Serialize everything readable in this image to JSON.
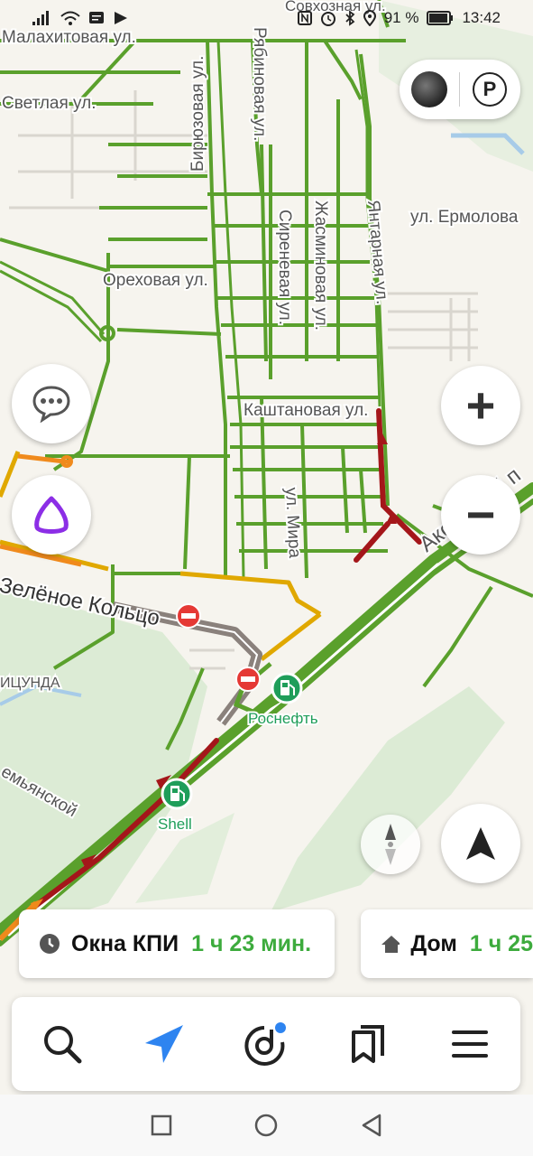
{
  "status_bar": {
    "battery_percent": "91 %",
    "time": "13:42"
  },
  "map": {
    "street_labels": {
      "malakhitovaya": "Малахитовая ул.",
      "sovkhoznaya": "Совхозная ул.",
      "svetlaya": "Светлая ул.",
      "biryuzovaya": "Бирюзовая ул.",
      "ryabinovaya": "Рябиновая ул.",
      "zhasminovaya": "Жасминовая ул.",
      "sirenevaya": "Сиреневая ул.",
      "yantarnaya": "Янтарная ул.",
      "ermolova": "ул. Ермолова",
      "orekhovaya": "Ореховая ул.",
      "kashtanovaya": "Каштановая ул.",
      "mira": "ул. Мира",
      "aksayskiy": "Аксайский п",
      "zelenoe_koltso": "Зелёное Кольцо",
      "pitsunda": "ИЦУНДА",
      "demyanskoy": "емьянской"
    },
    "pois": [
      {
        "name": "Роснефть",
        "icon": "fuel-station-icon"
      },
      {
        "name": "Shell",
        "icon": "fuel-station-icon"
      }
    ],
    "colors": {
      "traffic_free": "#5aa02c",
      "traffic_slow": "#e0a800",
      "traffic_jam": "#a4161a",
      "road_closed": "#8a817c",
      "closure_marker": "#e53935",
      "poi_green": "#1f9e5a"
    }
  },
  "map_controls": {
    "layers_icon": "layers-circle-icon",
    "parking_label": "P",
    "zoom_in_label": "+",
    "zoom_out_label": "−"
  },
  "route_cards": [
    {
      "name": "Окна КПИ",
      "time": "1 ч 23 мин.",
      "icon": "clock-icon"
    },
    {
      "name": "Дом",
      "time": "1 ч 25",
      "icon": "home-icon"
    }
  ],
  "bottom_nav": {
    "items": [
      "search-icon",
      "navigation-arrow-icon",
      "music-icon",
      "bookmarks-icon",
      "menu-icon"
    ]
  }
}
